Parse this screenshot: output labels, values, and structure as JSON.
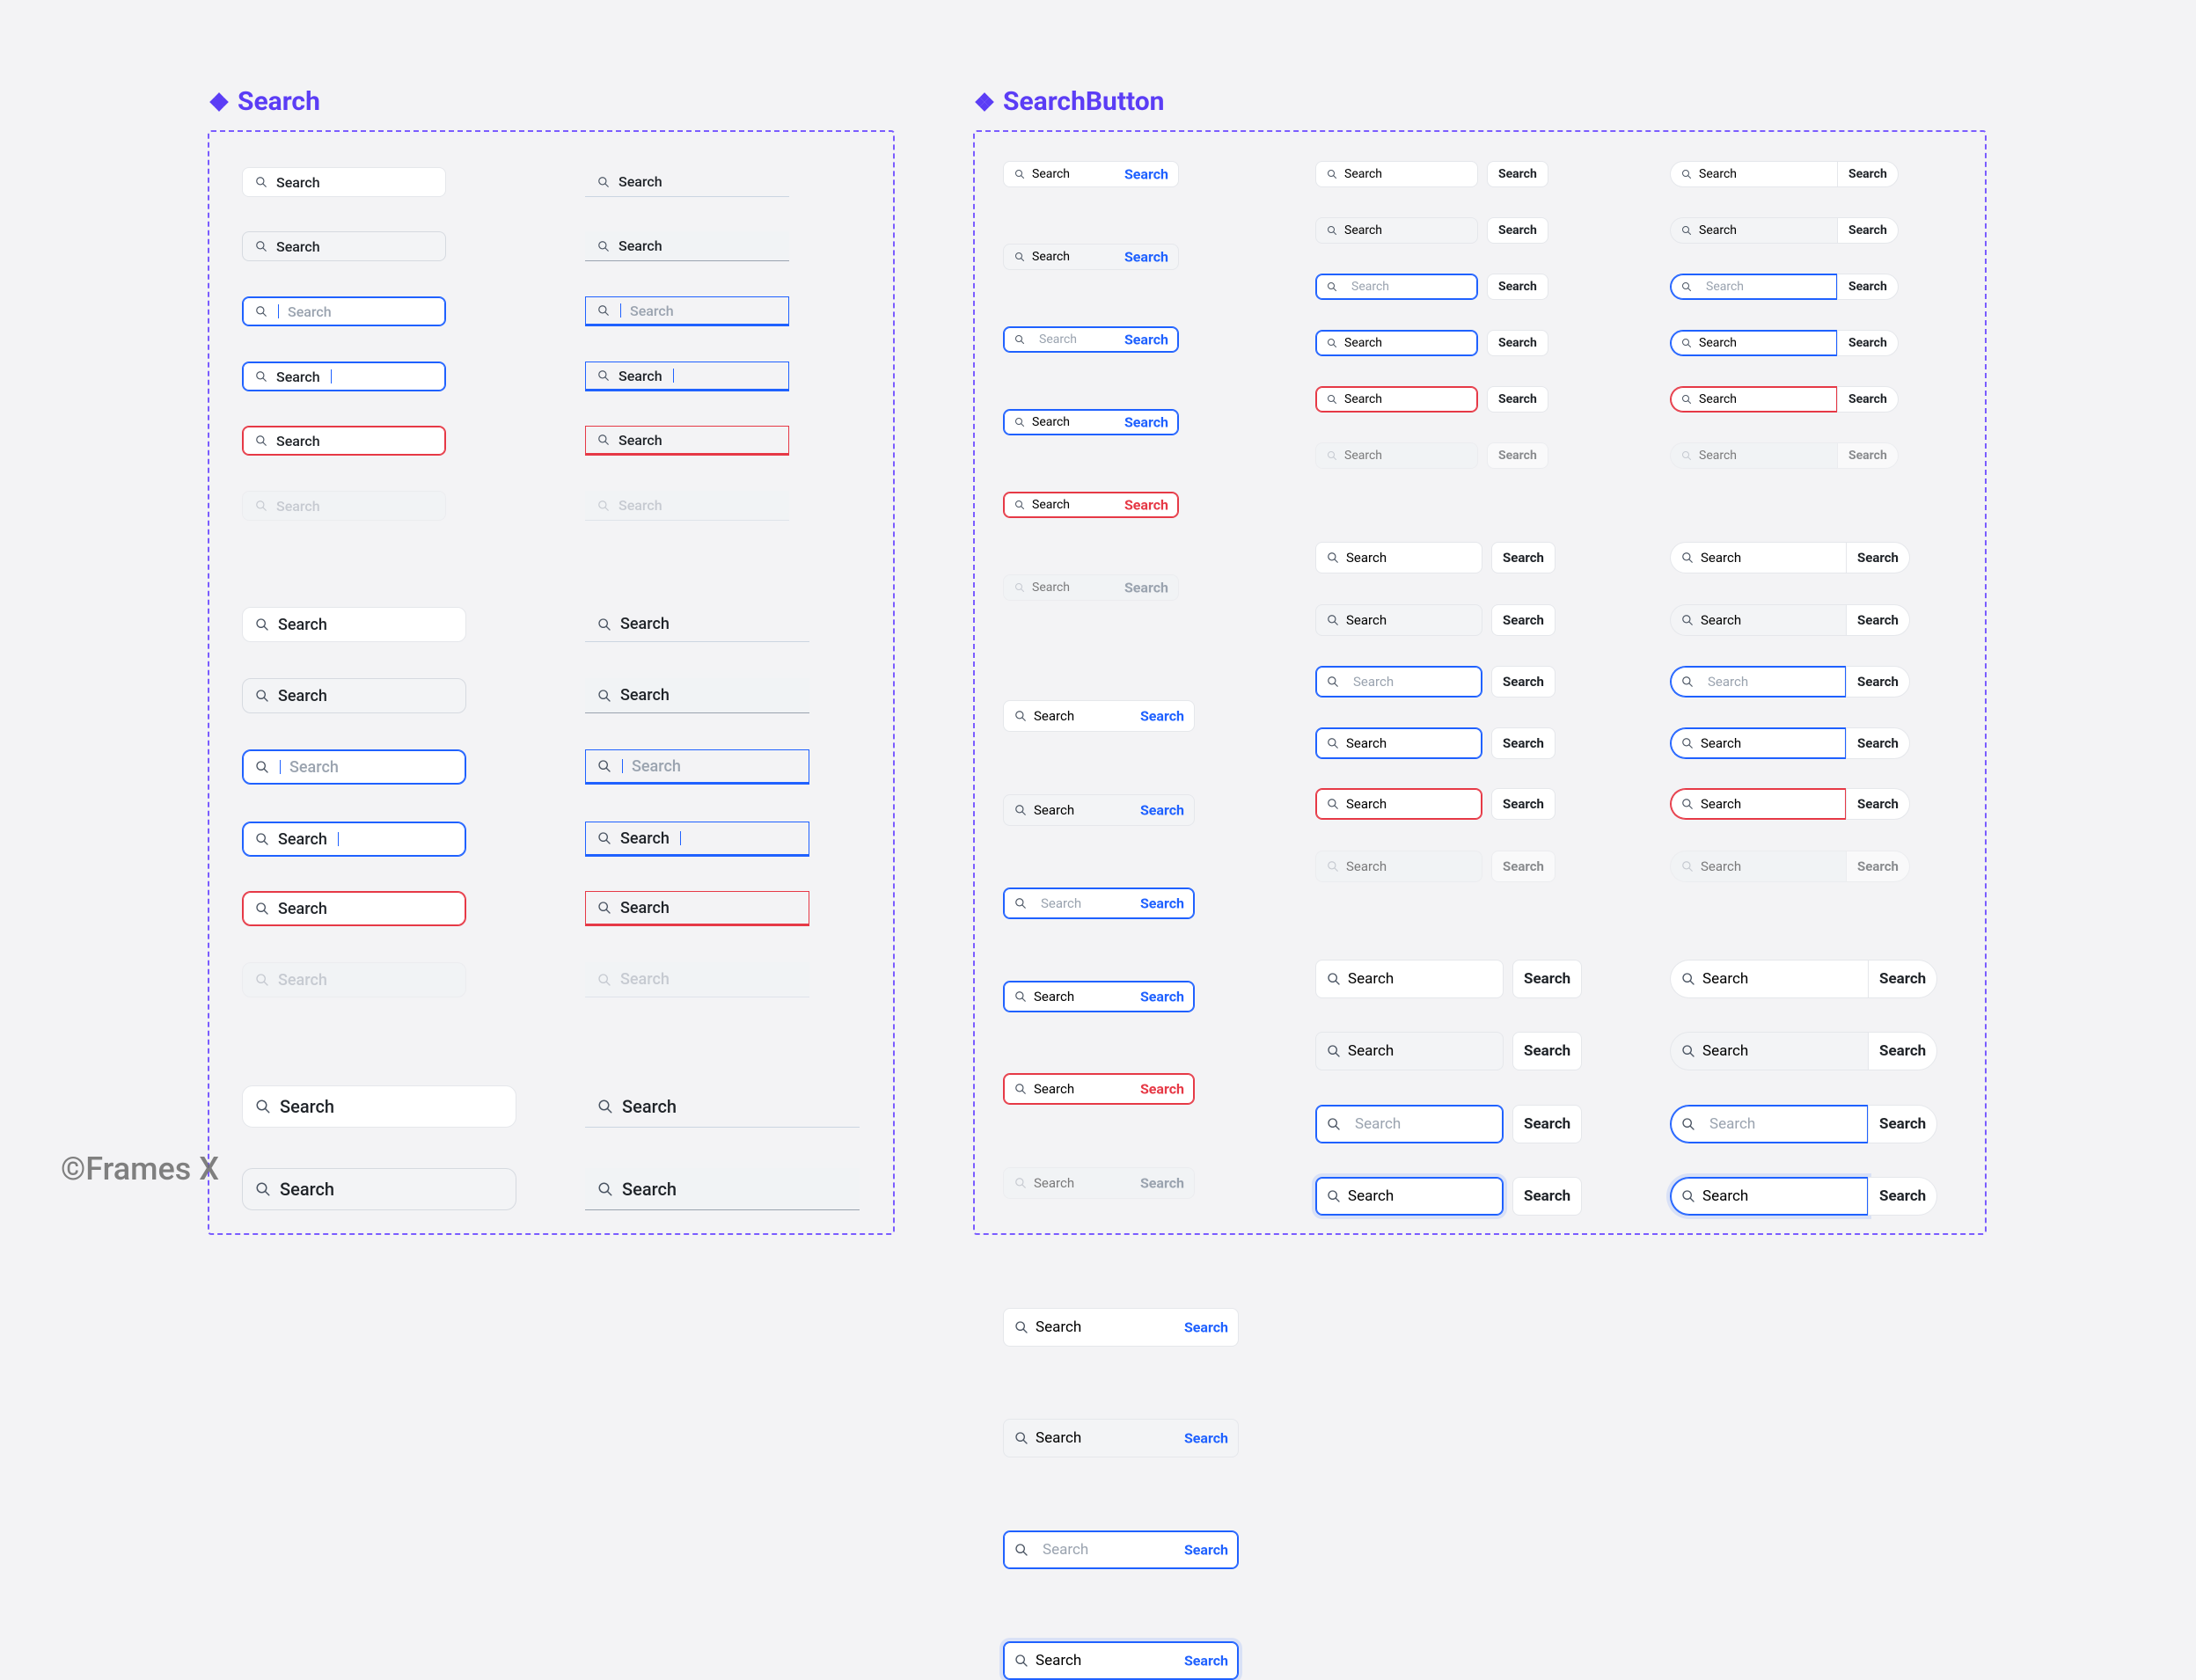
{
  "watermark": "©Frames X",
  "components": {
    "search": {
      "title": "Search"
    },
    "searchButton": {
      "title": "SearchButton"
    }
  },
  "text": {
    "search_value": "Search",
    "search_button_label": "Search",
    "search_placeholder": "Search",
    "search_typing": "Search"
  },
  "colors": {
    "accent": "#5b3df5",
    "focus": "#1f61ff",
    "error": "#e63946",
    "border": "#e5e7eb",
    "text": "#1f2328",
    "muted": "#9aa3af"
  },
  "states": [
    "default",
    "hover",
    "focus",
    "typing",
    "error",
    "disabled"
  ],
  "searchVariants": [
    "round",
    "line"
  ],
  "searchButtonVariants": [
    "inner-blue",
    "outer-default",
    "outer-merged-pill"
  ]
}
